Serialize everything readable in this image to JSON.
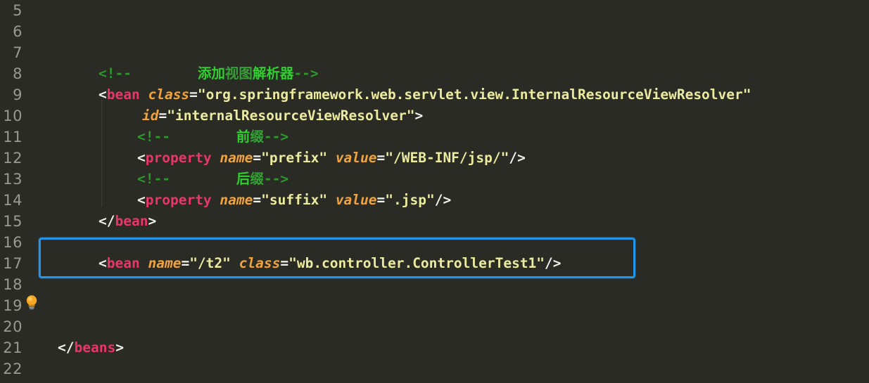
{
  "editor": {
    "kind": "xml-code-editor",
    "theme": "dark",
    "background_color": "#2b2b26",
    "font_size_px": 19.5,
    "line_height_px": 30,
    "first_visible_line": 5,
    "last_visible_line": 22,
    "gutter": {
      "line_numbers": [
        "5",
        "6",
        "7",
        "8",
        "9",
        "10",
        "11",
        "12",
        "13",
        "14",
        "15",
        "16",
        "17",
        "18",
        "19",
        "20",
        "21",
        "22"
      ]
    },
    "highlight": {
      "kind": "selection-rectangle",
      "color": "#2196e8",
      "target_line": 17
    },
    "intention_icon": {
      "name": "lightbulb-icon",
      "line": 19,
      "color": "#f5a623"
    },
    "colors": {
      "tag": "#e8366a",
      "attribute_name": "#f0a33c",
      "attribute_value": "#eaeaa0",
      "punctuation": "#f2f2ee",
      "comment": "#2a9a2a",
      "comment_cjk": "#2fcf2f",
      "highlight_blue": "#2196e8",
      "gutter_text": "#9a9a92"
    },
    "lines": [
      {
        "number": "5",
        "indent": 0,
        "tokens": []
      },
      {
        "number": "6",
        "indent": 0,
        "tokens": []
      },
      {
        "number": "7",
        "indent": 0,
        "tokens": []
      },
      {
        "number": "8",
        "indent": 78,
        "tokens": [
          {
            "t": "cmt",
            "s": "<!--"
          },
          {
            "t": "cmt",
            "s": "        "
          },
          {
            "t": "cmt-cjk",
            "s": "添加"
          },
          {
            "t": "cmt-cjk-dim",
            "s": "视图"
          },
          {
            "t": "cmt-cjk",
            "s": "解析器"
          },
          {
            "t": "cmt",
            "s": "-->"
          }
        ]
      },
      {
        "number": "9",
        "indent": 78,
        "tokens": [
          {
            "t": "punc",
            "s": "<"
          },
          {
            "t": "tag",
            "s": "bean"
          },
          {
            "t": "punc",
            "s": " "
          },
          {
            "t": "attr",
            "s": "class"
          },
          {
            "t": "eq",
            "s": "="
          },
          {
            "t": "val",
            "s": "\"org.springframework.web.servlet.view.InternalResourceViewResolver\""
          }
        ]
      },
      {
        "number": "10",
        "indent": 140,
        "tokens": [
          {
            "t": "attr",
            "s": "id"
          },
          {
            "t": "eq",
            "s": "="
          },
          {
            "t": "val",
            "s": "\"internalResourceViewResolver\""
          },
          {
            "t": "punc",
            "s": ">"
          }
        ]
      },
      {
        "number": "11",
        "indent": 133,
        "tokens": [
          {
            "t": "cmt",
            "s": "<!--"
          },
          {
            "t": "cmt",
            "s": "        "
          },
          {
            "t": "cmt-cjk",
            "s": "前"
          },
          {
            "t": "cmt-cjk-dim",
            "s": "缀"
          },
          {
            "t": "cmt",
            "s": "-->"
          }
        ]
      },
      {
        "number": "12",
        "indent": 133,
        "tokens": [
          {
            "t": "punc",
            "s": "<"
          },
          {
            "t": "tag",
            "s": "property"
          },
          {
            "t": "punc",
            "s": " "
          },
          {
            "t": "attr",
            "s": "name"
          },
          {
            "t": "eq",
            "s": "="
          },
          {
            "t": "val",
            "s": "\"prefix\""
          },
          {
            "t": "punc",
            "s": " "
          },
          {
            "t": "attr",
            "s": "value"
          },
          {
            "t": "eq",
            "s": "="
          },
          {
            "t": "val",
            "s": "\"/WEB-INF/jsp/\""
          },
          {
            "t": "punc",
            "s": "/>"
          }
        ]
      },
      {
        "number": "13",
        "indent": 133,
        "tokens": [
          {
            "t": "cmt",
            "s": "<!--"
          },
          {
            "t": "cmt",
            "s": "        "
          },
          {
            "t": "cmt-cjk",
            "s": "后"
          },
          {
            "t": "cmt-cjk-dim",
            "s": "缀"
          },
          {
            "t": "cmt",
            "s": "-->"
          }
        ]
      },
      {
        "number": "14",
        "indent": 133,
        "tokens": [
          {
            "t": "punc",
            "s": "<"
          },
          {
            "t": "tag",
            "s": "property"
          },
          {
            "t": "punc",
            "s": " "
          },
          {
            "t": "attr",
            "s": "name"
          },
          {
            "t": "eq",
            "s": "="
          },
          {
            "t": "val",
            "s": "\"suffix\""
          },
          {
            "t": "punc",
            "s": " "
          },
          {
            "t": "attr",
            "s": "value"
          },
          {
            "t": "eq",
            "s": "="
          },
          {
            "t": "val",
            "s": "\".jsp\""
          },
          {
            "t": "punc",
            "s": "/>"
          }
        ]
      },
      {
        "number": "15",
        "indent": 78,
        "tokens": [
          {
            "t": "punc",
            "s": "</"
          },
          {
            "t": "tag",
            "s": "bean"
          },
          {
            "t": "punc",
            "s": ">"
          }
        ]
      },
      {
        "number": "16",
        "indent": 0,
        "tokens": []
      },
      {
        "number": "17",
        "indent": 78,
        "tokens": [
          {
            "t": "punc",
            "s": "<"
          },
          {
            "t": "tag",
            "s": "bean"
          },
          {
            "t": "punc",
            "s": " "
          },
          {
            "t": "attr",
            "s": "name"
          },
          {
            "t": "eq",
            "s": "="
          },
          {
            "t": "val",
            "s": "\"/t2\""
          },
          {
            "t": "punc",
            "s": " "
          },
          {
            "t": "attr",
            "s": "class"
          },
          {
            "t": "eq",
            "s": "="
          },
          {
            "t": "val",
            "s": "\"wb.controller.ControllerTest1\""
          },
          {
            "t": "punc",
            "s": "/>"
          }
        ]
      },
      {
        "number": "18",
        "indent": 0,
        "tokens": []
      },
      {
        "number": "19",
        "indent": 0,
        "tokens": []
      },
      {
        "number": "20",
        "indent": 0,
        "tokens": []
      },
      {
        "number": "21",
        "indent": 20,
        "tokens": [
          {
            "t": "punc",
            "s": "</"
          },
          {
            "t": "tag",
            "s": "beans"
          },
          {
            "t": "punc",
            "s": ">"
          }
        ]
      },
      {
        "number": "22",
        "indent": 0,
        "tokens": []
      }
    ]
  }
}
